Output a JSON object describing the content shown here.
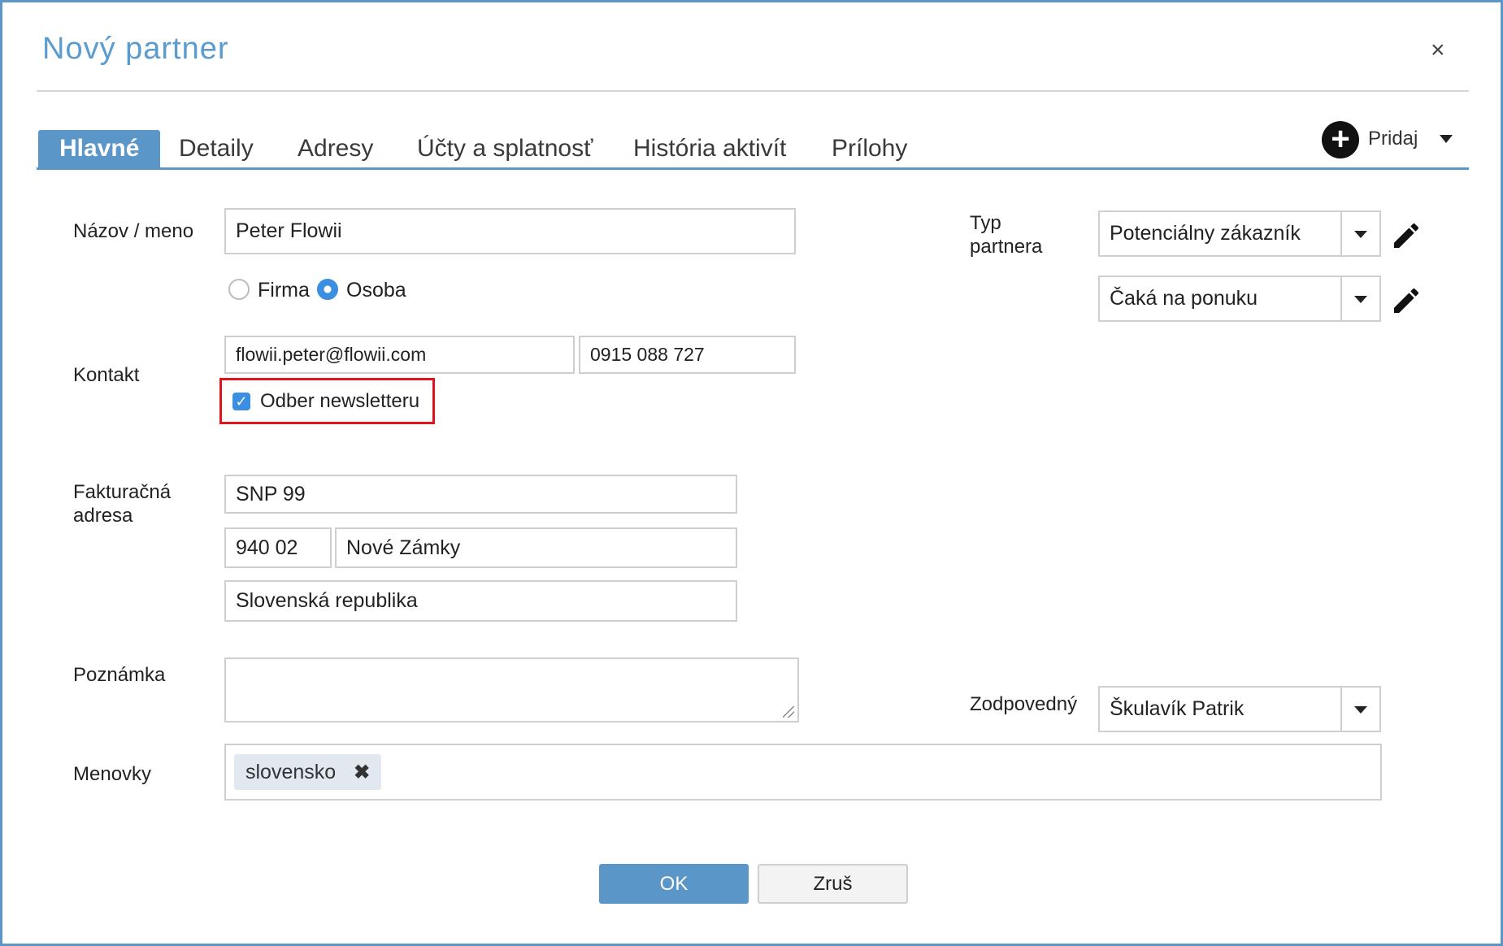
{
  "dialog": {
    "title": "Nový partner",
    "close_icon": "×"
  },
  "tabs": [
    {
      "label": "Hlavné",
      "active": true
    },
    {
      "label": "Detaily"
    },
    {
      "label": "Adresy"
    },
    {
      "label": "Účty a splatnosť"
    },
    {
      "label": "História aktivít"
    },
    {
      "label": "Prílohy"
    }
  ],
  "add_menu": {
    "icon": "+",
    "label": "Pridaj"
  },
  "form": {
    "name_label": "Názov / meno",
    "name_value": "Peter Flowii",
    "type_options": [
      {
        "label": "Firma",
        "selected": false
      },
      {
        "label": "Osoba",
        "selected": true
      }
    ],
    "contact_label": "Kontakt",
    "email_value": "flowii.peter@flowii.com",
    "phone_value": "0915 088 727",
    "newsletter_label": "Odber newsletteru",
    "newsletter_checked": true,
    "billing_label_1": "Fakturačná",
    "billing_label_2": "adresa",
    "street_value": "SNP 99",
    "zip_value": "940 02",
    "city_value": "Nové Zámky",
    "country_value": "Slovenská republika",
    "note_label": "Poznámka",
    "note_value": "",
    "tags_label": "Menovky",
    "tags": [
      {
        "label": "slovensko",
        "remove_icon": "✖"
      }
    ],
    "partner_type_label_1": "Typ",
    "partner_type_label_2": "partnera",
    "partner_type_value": "Potenciálny zákazník",
    "status_value": "Čaká na ponuku",
    "responsible_label": "Zodpovedný",
    "responsible_value": "Škulavík Patrik"
  },
  "buttons": {
    "ok": "OK",
    "cancel": "Zruš"
  },
  "colors": {
    "accent": "#5b96c8",
    "highlight": "#e3131c",
    "checkbox": "#3b8ee0"
  }
}
